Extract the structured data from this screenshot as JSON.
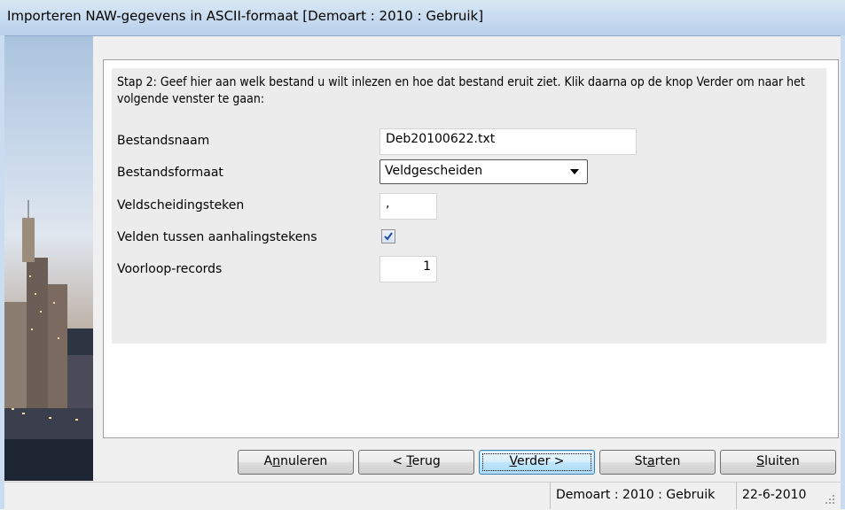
{
  "window": {
    "title": "Importeren NAW-gegevens in ASCII-formaat  [Demoart : 2010 : Gebruik]"
  },
  "step": {
    "instruction": "Stap 2: Geef hier aan welk bestand u wilt inlezen en hoe dat bestand eruit ziet. Klik daarna op de knop Verder om naar het volgende venster te gaan:"
  },
  "form": {
    "bestandsnaam": {
      "label": "Bestandsnaam",
      "value": "Deb20100622.txt"
    },
    "bestandsformaat": {
      "label": "Bestandsformaat",
      "value": "Veldgescheiden"
    },
    "veldscheidingsteken": {
      "label": "Veldscheidingsteken",
      "value": ","
    },
    "aanhalingstekens": {
      "label": "Velden tussen aanhalingstekens",
      "checked": true
    },
    "voorloop": {
      "label": "Voorloop-records",
      "value": "1"
    }
  },
  "buttons": {
    "annuleren": {
      "pre": "A",
      "u": "n",
      "post": "nuleren"
    },
    "terug": {
      "pre": "< ",
      "u": "T",
      "post": "erug"
    },
    "verder": {
      "pre": "",
      "u": "V",
      "post": "erder >"
    },
    "starten": {
      "pre": "St",
      "u": "a",
      "post": "rten"
    },
    "sluiten": {
      "pre": "",
      "u": "S",
      "post": "luiten"
    }
  },
  "statusbar": {
    "context": "Demoart : 2010 : Gebruik",
    "date": "22-6-2010"
  },
  "sidebar": {
    "image": "city-skyline-picture"
  },
  "icons": {
    "dropdown": "chevron-down-icon",
    "check": "checkmark-icon",
    "grip": "resize-grip-icon"
  }
}
